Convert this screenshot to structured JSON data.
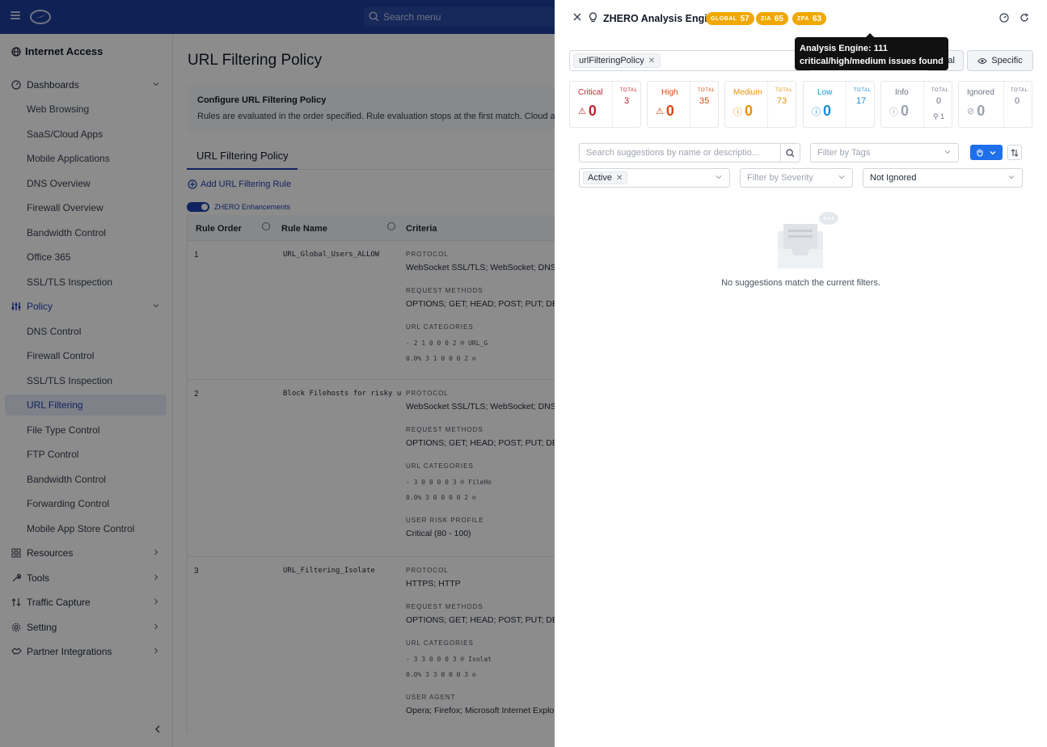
{
  "topbar": {
    "search_placeholder": "Search menu"
  },
  "sidebar": {
    "section_title": "Internet Access",
    "groups": [
      {
        "label": "Dashboards",
        "items": [
          "Web Browsing",
          "SaaS/Cloud Apps",
          "Mobile Applications",
          "DNS Overview",
          "Firewall Overview",
          "Bandwidth Control",
          "Office 365",
          "SSL/TLS Inspection"
        ]
      },
      {
        "label": "Policy",
        "items": [
          "DNS Control",
          "Firewall Control",
          "SSL/TLS Inspection",
          "URL Filtering",
          "File Type Control",
          "FTP Control",
          "Bandwidth Control",
          "Forwarding Control",
          "Mobile App Store Control"
        ]
      },
      {
        "label": "Resources"
      },
      {
        "label": "Tools"
      },
      {
        "label": "Traffic Capture"
      },
      {
        "label": "Setting"
      },
      {
        "label": "Partner Integrations"
      }
    ]
  },
  "main": {
    "page_title": "URL Filtering Policy",
    "info_title": "Configure URL Filtering Policy",
    "info_text": "Rules are evaluated in the order specified. Rule evaluation stops at the first match. Cloud app c",
    "tab_label": "URL Filtering Policy",
    "add_rule_label": "Add URL Filtering Rule",
    "zhero_label": "ZHERO Enhancements",
    "table": {
      "headers": [
        "Rule Order",
        "Rule Name",
        "Criteria"
      ],
      "rows": [
        {
          "order": "1",
          "name": "URL_Global_Users_ALLOW",
          "criteria": [
            {
              "label": "PROTOCOL",
              "value": "WebSocket SSL/TLS; WebSocket; DNS"
            },
            {
              "label": "REQUEST METHODS",
              "value": "OPTIONS; GET; HEAD; POST; PUT; DEL"
            },
            {
              "label": "URL CATEGORIES",
              "mono1": "-  2  1  0  0  0  2  ® URL_G",
              "mono2": "0.0% 3  1  0  0  0  2  ⊘"
            }
          ]
        },
        {
          "order": "2",
          "name": "Block Filehosts for risky u",
          "criteria": [
            {
              "label": "PROTOCOL",
              "value": "WebSocket SSL/TLS; WebSocket; DNS"
            },
            {
              "label": "REQUEST METHODS",
              "value": "OPTIONS; GET; HEAD; POST; PUT; DEL"
            },
            {
              "label": "URL CATEGORIES",
              "mono1": "-  3  0  0  0  0  3  ® FileHo",
              "mono2": "0.0% 3  0  0  0  0  2  ⊘"
            },
            {
              "label": "USER RISK PROFILE",
              "value": "Critical (80 - 100)"
            }
          ]
        },
        {
          "order": "3",
          "name": "URL_Filtering_Isolate",
          "criteria": [
            {
              "label": "PROTOCOL",
              "value": "HTTPS; HTTP"
            },
            {
              "label": "REQUEST METHODS",
              "value": "OPTIONS; GET; HEAD; POST; PUT; DEL"
            },
            {
              "label": "URL CATEGORIES",
              "mono1": "-  3  3  0  0  0  3  ® Isolat",
              "mono2": "0.0% 3  3  0  0  0  3  ⊘"
            },
            {
              "label": "USER AGENT",
              "value": "Opera; Firefox; Microsoft Internet Explo"
            }
          ]
        }
      ]
    }
  },
  "drawer": {
    "title": "ZHERO Analysis Engine",
    "pills": [
      {
        "label": "GLOBAL",
        "value": "57"
      },
      {
        "label": "ZIA",
        "value": "65"
      },
      {
        "label": "ZPA",
        "value": "63"
      }
    ],
    "filter_chip": "urlFilteringPolicy",
    "scope_general_partial": "ral",
    "scope_specific": "Specific",
    "tooltip_line1": "Analysis Engine: 111",
    "tooltip_line2": "critical/high/medium issues found",
    "severity": [
      {
        "name": "Critical",
        "count": "0",
        "total_label": "TOTAL",
        "total": "3",
        "color": "#c0262d"
      },
      {
        "name": "High",
        "count": "0",
        "total_label": "TOTAL",
        "total": "35",
        "color": "#d9480f"
      },
      {
        "name": "Medium",
        "count": "0",
        "total_label": "TOTAL",
        "total": "73",
        "color": "#e8900c"
      },
      {
        "name": "Low",
        "count": "0",
        "total_label": "TOTAL",
        "total": "17",
        "color": "#1c8fd6"
      },
      {
        "name": "Info",
        "count": "0",
        "total_label": "TOTAL",
        "total": "0",
        "extra": "1",
        "color": "#6b7280"
      },
      {
        "name": "Ignored",
        "count": "0",
        "total_label": "TOTAL",
        "total": "0",
        "color": "#6b7280"
      }
    ],
    "search_placeholder": "Search suggestions by name or descriptio...",
    "tags_placeholder": "Filter by Tags",
    "status_value": "Active",
    "severity_placeholder": "Filter by Severity",
    "ignored_value": "Not Ignored",
    "empty_text": "No suggestions match the current filters."
  }
}
